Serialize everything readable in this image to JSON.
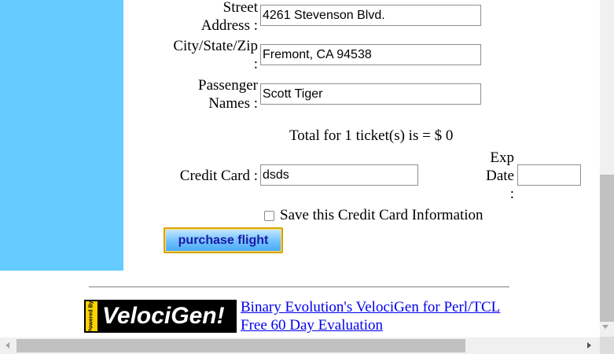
{
  "form": {
    "street_label_1": "Street",
    "street_label_2": "Address :",
    "street_value": "4261 Stevenson Blvd.",
    "city_label_1": "City/State/Zip",
    "city_label_2": ":",
    "city_value": "Fremont, CA 94538",
    "passenger_label_1": "Passenger",
    "passenger_label_2": "Names :",
    "passenger_value": "Scott Tiger",
    "total_text": "Total for 1 ticket(s) is = $ 0",
    "cc_label": "Credit Card :",
    "cc_value": "dsds",
    "exp_label_1": "Exp",
    "exp_label_2": "Date",
    "exp_label_3": ":",
    "exp_value": "",
    "save_cc_label": "Save this Credit Card Information",
    "save_cc_checked": false,
    "purchase_label": "purchase flight"
  },
  "footer": {
    "logo_badge": "Powered By",
    "logo_text": "VelociGen!",
    "link_main": "Binary Evolution's VelociGen for Perl/TCL",
    "link_eval": "Free 60 Day Evaluation"
  },
  "colors": {
    "sidebar": "#66ccff",
    "link": "#0000ee",
    "button_border": "#d7a400",
    "button_text": "#1a1aa6"
  },
  "icons": {
    "scroll_left": "scroll-left-arrow-icon",
    "scroll_right": "scroll-right-arrow-icon",
    "scroll_down": "scroll-down-arrow-icon"
  }
}
